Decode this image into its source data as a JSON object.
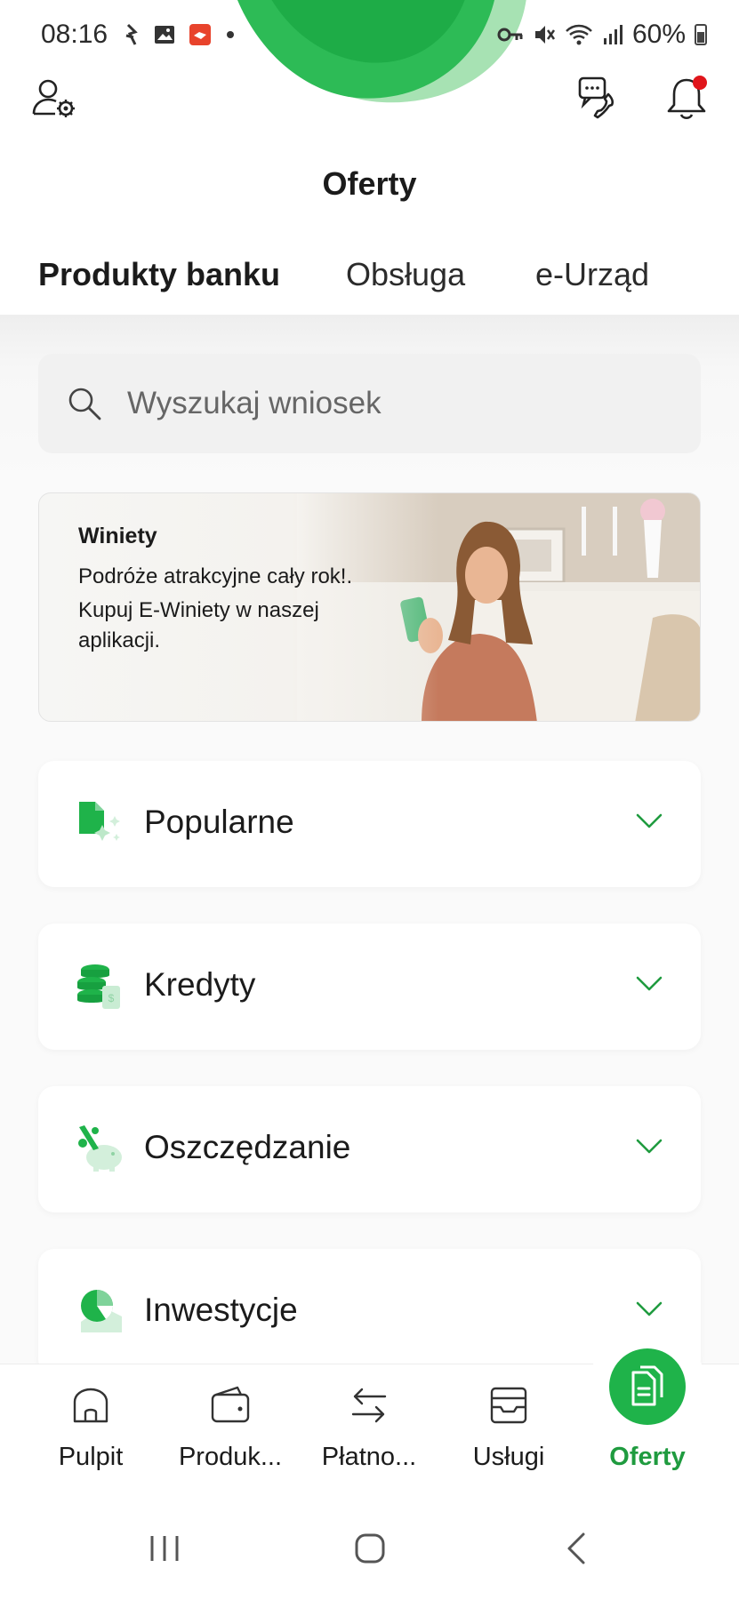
{
  "status_bar": {
    "time": "08:16",
    "battery": "60%",
    "left_icons": [
      "sync-icon",
      "gallery-icon",
      "app-notification-icon",
      "dot-icon"
    ],
    "right_icons": [
      "vpn-key-icon",
      "mute-icon",
      "wifi-icon",
      "signal-icon",
      "battery-icon"
    ]
  },
  "header": {
    "title": "Oferty",
    "notification_dot_color": "#e0151b"
  },
  "tabs": [
    {
      "label": "Produkty banku",
      "active": true
    },
    {
      "label": "Obsługa",
      "active": false
    },
    {
      "label": "e-Urząd",
      "active": false
    }
  ],
  "search": {
    "placeholder": "Wyszukaj wniosek"
  },
  "banner": {
    "title": "Winiety",
    "line1": "Podróże atrakcyjne cały rok!.",
    "line2": "Kupuj E-Winiety w naszej aplikacji."
  },
  "categories": [
    {
      "label": "Popularne",
      "icon": "document-sparkle-icon"
    },
    {
      "label": "Kredyty",
      "icon": "coins-stack-icon"
    },
    {
      "label": "Oszczędzanie",
      "icon": "piggy-bank-icon"
    },
    {
      "label": "Inwestycje",
      "icon": "pie-chart-icon"
    }
  ],
  "bottom_nav": [
    {
      "label": "Pulpit",
      "icon": "home-icon",
      "active": false
    },
    {
      "label": "Produk...",
      "icon": "wallet-icon",
      "active": false
    },
    {
      "label": "Płatno...",
      "icon": "transfer-arrows-icon",
      "active": false
    },
    {
      "label": "Usługi",
      "icon": "services-tray-icon",
      "active": false
    },
    {
      "label": "Oferty",
      "icon": "offers-document-icon",
      "active": true
    }
  ],
  "colors": {
    "accent": "#1fb34a",
    "accent_text": "#1f9b3f",
    "chevron": "#1f9b3f"
  }
}
